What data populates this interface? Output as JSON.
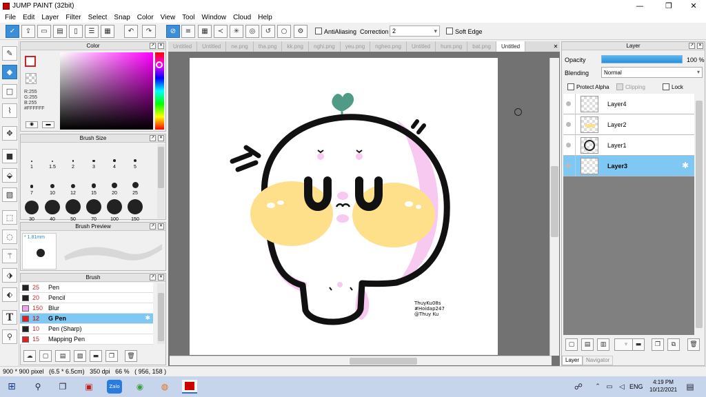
{
  "window": {
    "title": "JUMP PAINT (32bit)",
    "minimize": "—",
    "maximize": "❐",
    "close": "✕"
  },
  "menu": [
    "File",
    "Edit",
    "Layer",
    "Filter",
    "Select",
    "Snap",
    "Color",
    "View",
    "Tool",
    "Window",
    "Cloud",
    "Help"
  ],
  "toolbar": {
    "antialias_label": "AntiAliasing",
    "correction_label": "Correction",
    "correction_value": "2",
    "soft_edge_label": "Soft Edge"
  },
  "color_panel": {
    "title": "Color",
    "r": "R:255",
    "g": "G:255",
    "b": "B:255",
    "hex": "#FFFFFF",
    "hue_color": "#ff00ff"
  },
  "brush_size_panel": {
    "title": "Brush Size",
    "sizes": [
      "1",
      "1.5",
      "2",
      "3",
      "4",
      "5",
      "7",
      "10",
      "12",
      "15",
      "20",
      "25",
      "30",
      "40",
      "50",
      "70",
      "100",
      "150"
    ]
  },
  "brush_preview_panel": {
    "title": "Brush Preview",
    "size_label": "* 1.81mm"
  },
  "brush_panel": {
    "title": "Brush",
    "items": [
      {
        "size": "25",
        "name": "Pen",
        "color": "#222222"
      },
      {
        "size": "20",
        "name": "Pencil",
        "color": "#222222"
      },
      {
        "size": "150",
        "name": "Blur",
        "color": "#f0a0f0"
      },
      {
        "size": "12",
        "name": "G Pen",
        "color": "#e02020"
      },
      {
        "size": "10",
        "name": "Pen (Sharp)",
        "color": "#222222"
      },
      {
        "size": "15",
        "name": "Mapping Pen",
        "color": "#e02020"
      }
    ]
  },
  "tabs": [
    "Untitled",
    "Untitled",
    "ne.png",
    "tha.png",
    "kk.png",
    "nghi.png",
    "yeu.png",
    "ngheo.png",
    "Untitled",
    "hum.png",
    "bat.png",
    "Untitled"
  ],
  "canvas": {
    "watermark": [
      "ThuyKu08s",
      "#Hoidap247",
      "@Thuy Ku"
    ]
  },
  "layer_panel": {
    "title": "Layer",
    "opacity_label": "Opacity",
    "opacity_value": "100 %",
    "opacity_fraction": 1.0,
    "blending_label": "Blending",
    "blending_value": "Normal",
    "protect_alpha": "Protect Alpha",
    "clipping": "Clipping",
    "lock": "Lock",
    "layers": [
      "Layer4",
      "Layer2",
      "Layer1",
      "Layer3"
    ],
    "bottom_tabs": [
      "Layer",
      "Navigator"
    ]
  },
  "status": {
    "text": "900 * 900 pixel   (6.5 * 6.5cm)   350 dpi   66 %   ( 956, 158 )"
  },
  "taskbar": {
    "lang": "ENG",
    "time": "4:19 PM",
    "date": "10/12/2021"
  }
}
